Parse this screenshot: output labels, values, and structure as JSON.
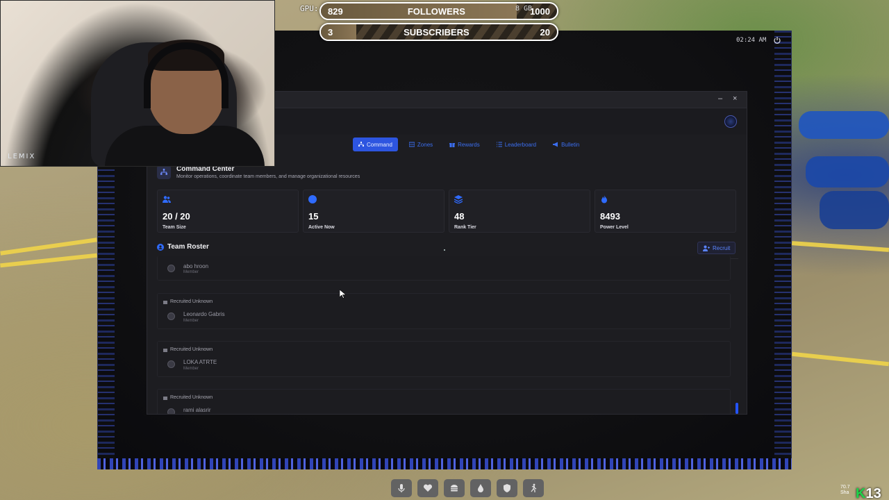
{
  "stream": {
    "gpu_label": "GPU:",
    "gb_label": "8 GB",
    "followers": {
      "current": "829",
      "label": "FOLLOWERS",
      "goal": "1000",
      "progress": 0.83
    },
    "subscribers": {
      "current": "3",
      "label": "SUBSCRIBERS",
      "goal": "20",
      "progress": 0.15
    },
    "webcam_label": "LEMIX"
  },
  "tablet": {
    "time": "02:24 AM"
  },
  "window": {
    "controls": {
      "minimize": "–",
      "close": "×"
    },
    "tabs": [
      {
        "label": "Command",
        "icon": "sitemap-icon",
        "active": true
      },
      {
        "label": "Zones",
        "icon": "grid-icon",
        "active": false
      },
      {
        "label": "Rewards",
        "icon": "gift-icon",
        "active": false
      },
      {
        "label": "Leaderboard",
        "icon": "list-icon",
        "active": false
      },
      {
        "label": "Bulletin",
        "icon": "megaphone-icon",
        "active": false
      }
    ],
    "section": {
      "title": "Command Center",
      "subtitle": "Monitor operations, coordinate team members, and manage organizational resources"
    },
    "stats": [
      {
        "value": "20 / 20",
        "label": "Team Size",
        "icon": "users-icon"
      },
      {
        "value": "15",
        "label": "Active Now",
        "icon": "status-dot-icon"
      },
      {
        "value": "48",
        "label": "Rank Tier",
        "icon": "layers-icon"
      },
      {
        "value": "8493",
        "label": "Power Level",
        "icon": "fire-icon"
      }
    ],
    "roster": {
      "title": "Team Roster",
      "recruit_label": "Recruit",
      "members": [
        {
          "recruited": "",
          "name": "abo hroon",
          "role": "Member"
        },
        {
          "recruited": "Recruited Unknown",
          "name": "Leonardo Gabris",
          "role": "Member"
        },
        {
          "recruited": "Recruited Unknown",
          "name": "LOKA ATRTE",
          "role": "Member"
        },
        {
          "recruited": "Recruited Unknown",
          "name": "rami alasrir",
          "role": ""
        }
      ]
    }
  },
  "hud": {
    "buttons": [
      "microphone-icon",
      "heart-icon",
      "burger-icon",
      "water-drop-icon",
      "shield-icon",
      "running-icon"
    ]
  },
  "overlay": {
    "corner_badge": "13",
    "fps_line1": "70.7",
    "fps_line2": "Sha"
  },
  "colors": {
    "accent": "#2d55e0",
    "panel": "#1d1d21",
    "tablet_edge": "#3a4fc0"
  }
}
